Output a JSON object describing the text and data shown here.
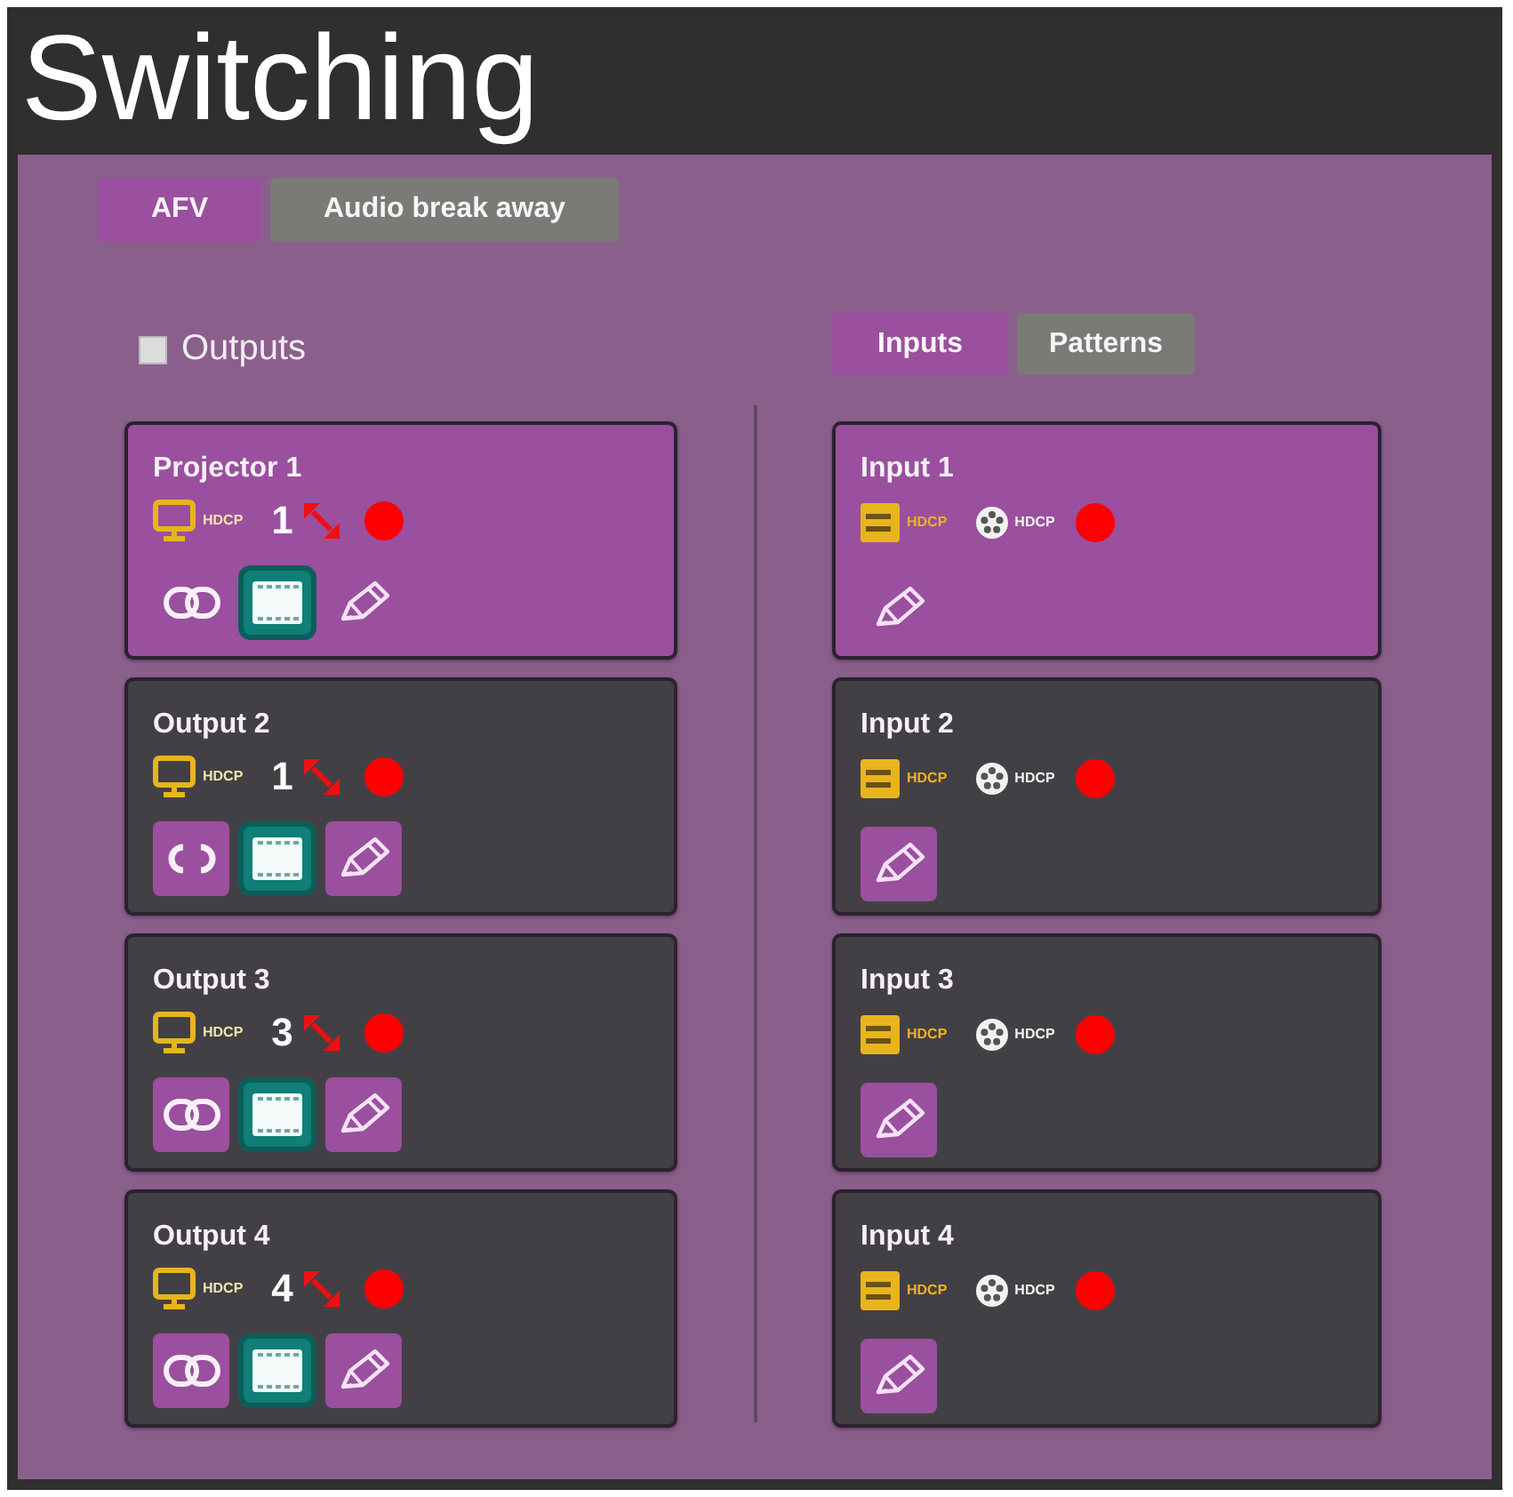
{
  "window": {
    "title": "Switching"
  },
  "mode_tabs": [
    {
      "label": "AFV",
      "selected": true
    },
    {
      "label": "Audio break away",
      "selected": false
    }
  ],
  "outputs_header": {
    "label": "Outputs",
    "checked": false
  },
  "source_tabs": [
    {
      "label": "Inputs",
      "selected": true
    },
    {
      "label": "Patterns",
      "selected": false
    }
  ],
  "outputs": [
    {
      "name": "Projector 1",
      "hdcp_label": "HDCP",
      "source": "1",
      "selected": true,
      "linked": true
    },
    {
      "name": "Output 2",
      "hdcp_label": "HDCP",
      "source": "1",
      "selected": false,
      "linked": false
    },
    {
      "name": "Output 3",
      "hdcp_label": "HDCP",
      "source": "3",
      "selected": false,
      "linked": true
    },
    {
      "name": "Output 4",
      "hdcp_label": "HDCP",
      "source": "4",
      "selected": false,
      "linked": true
    }
  ],
  "inputs": [
    {
      "name": "Input 1",
      "port_label": "HDCP",
      "reel_label": "HDCP",
      "selected": true
    },
    {
      "name": "Input 2",
      "port_label": "HDCP",
      "reel_label": "HDCP",
      "selected": false
    },
    {
      "name": "Input 3",
      "port_label": "HDCP",
      "reel_label": "HDCP",
      "selected": false
    },
    {
      "name": "Input 4",
      "port_label": "HDCP",
      "reel_label": "HDCP",
      "selected": false
    }
  ]
}
